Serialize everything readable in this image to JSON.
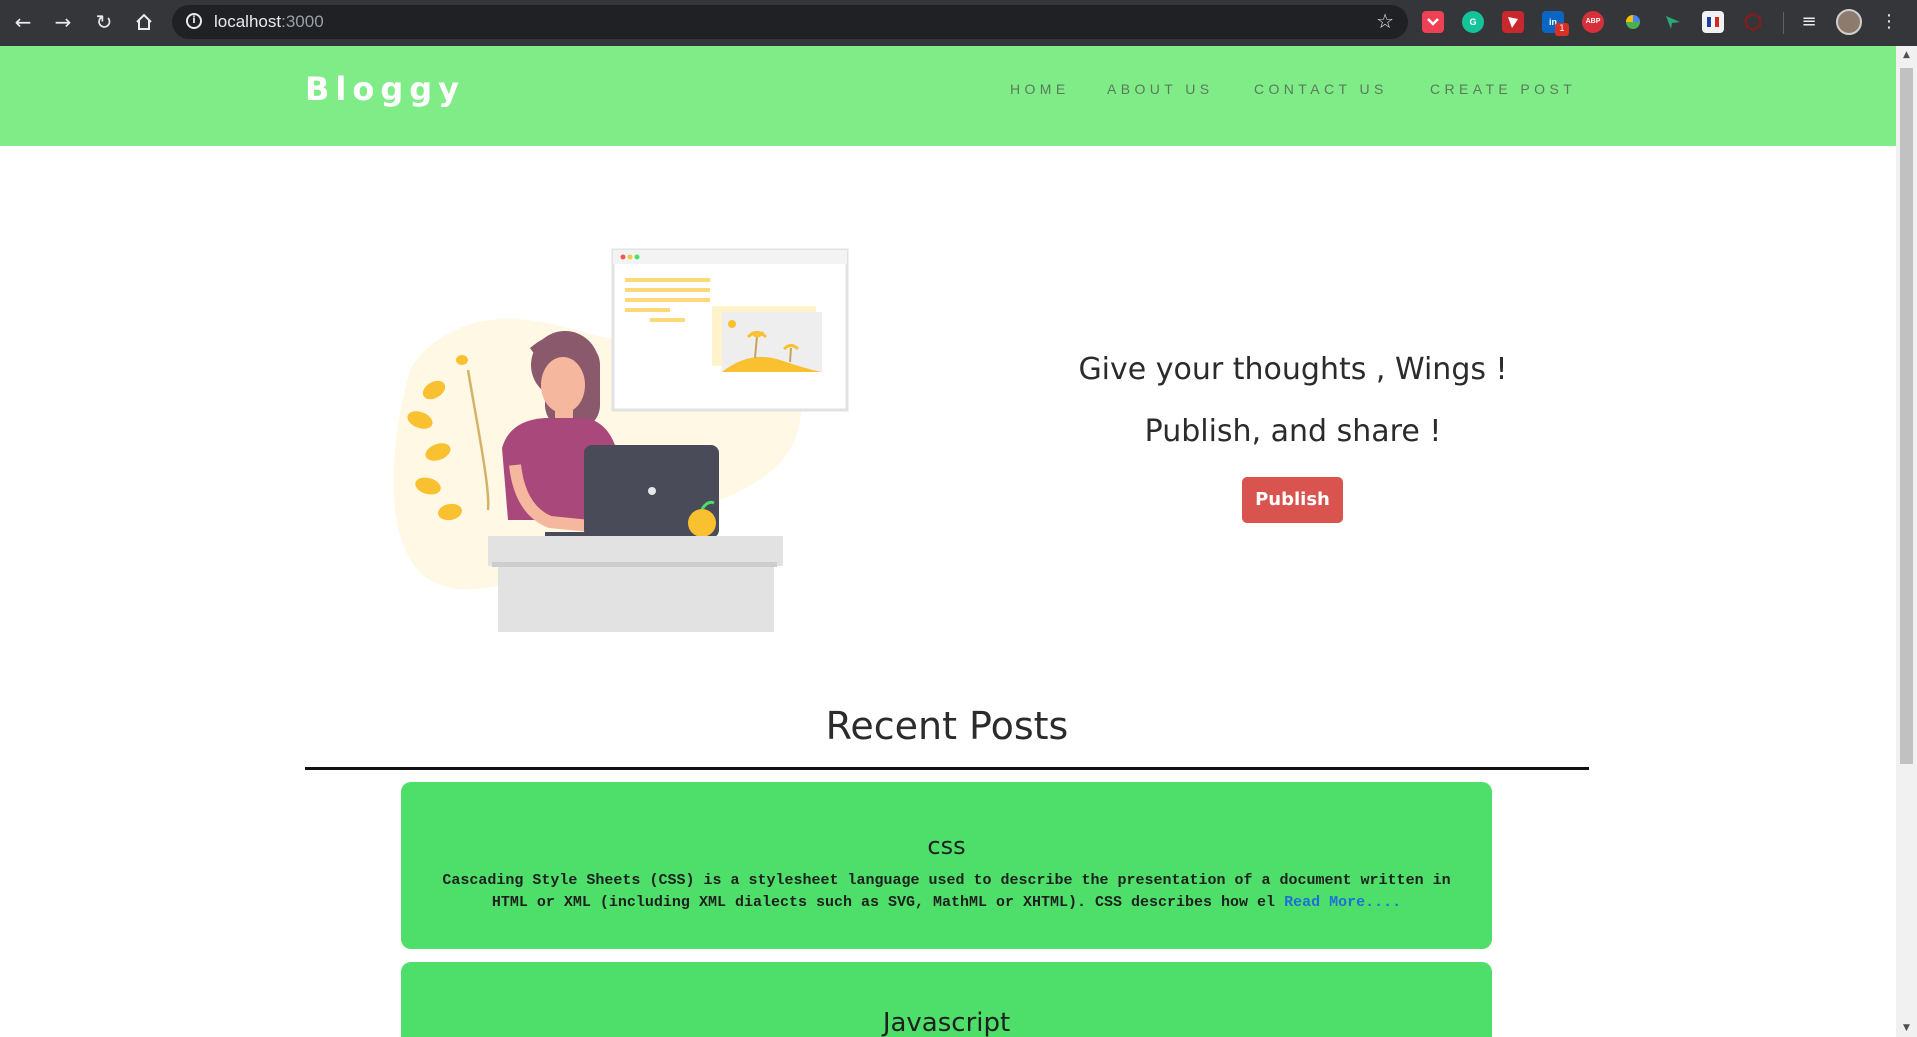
{
  "browser": {
    "url_host": "localhost",
    "url_port": ":3000",
    "extensions": [
      {
        "icon": "pocket-icon",
        "label": "",
        "color": "#ef4056"
      },
      {
        "icon": "grammarly-icon",
        "label": "G",
        "color": "#15c39a"
      },
      {
        "icon": "shield-icon",
        "label": "",
        "color": "#c9282d"
      },
      {
        "icon": "linkedin-icon",
        "label": "in",
        "color": "#0a66c2"
      },
      {
        "icon": "adblock-plus-icon",
        "label": "ABP",
        "color": "#d7303a"
      },
      {
        "icon": "colorful-leaf-icon",
        "label": "",
        "color": "#4caf50"
      },
      {
        "icon": "send-arrow-icon",
        "label": "",
        "color": "#2aa876"
      },
      {
        "icon": "flag-icon",
        "label": "",
        "color": "#f1f1f1"
      },
      {
        "icon": "red-hexagon-icon",
        "label": "",
        "color": "#8b1a1a"
      }
    ],
    "linkedin_badge": "1"
  },
  "site": {
    "brand": "Bloggy",
    "nav": [
      "HOME",
      "ABOUT US",
      "CONTACT US",
      "CREATE POST"
    ],
    "colors": {
      "header": "#80ec87",
      "card": "#4ddf69",
      "button": "#d9534f",
      "link": "#1f6fd9"
    }
  },
  "hero": {
    "line1": "Give your thoughts , Wings !",
    "line2": "Publish, and share !",
    "button": "Publish"
  },
  "recent": {
    "title": "Recent Posts",
    "posts": [
      {
        "title": "css",
        "excerpt": "Cascading Style Sheets (CSS) is a stylesheet language used to describe the presentation of a document written in HTML or XML (including XML dialects such as SVG, MathML or XHTML). CSS describes how el",
        "read_more": "Read More...."
      },
      {
        "title": "Javascript",
        "excerpt": "",
        "read_more": ""
      }
    ]
  }
}
